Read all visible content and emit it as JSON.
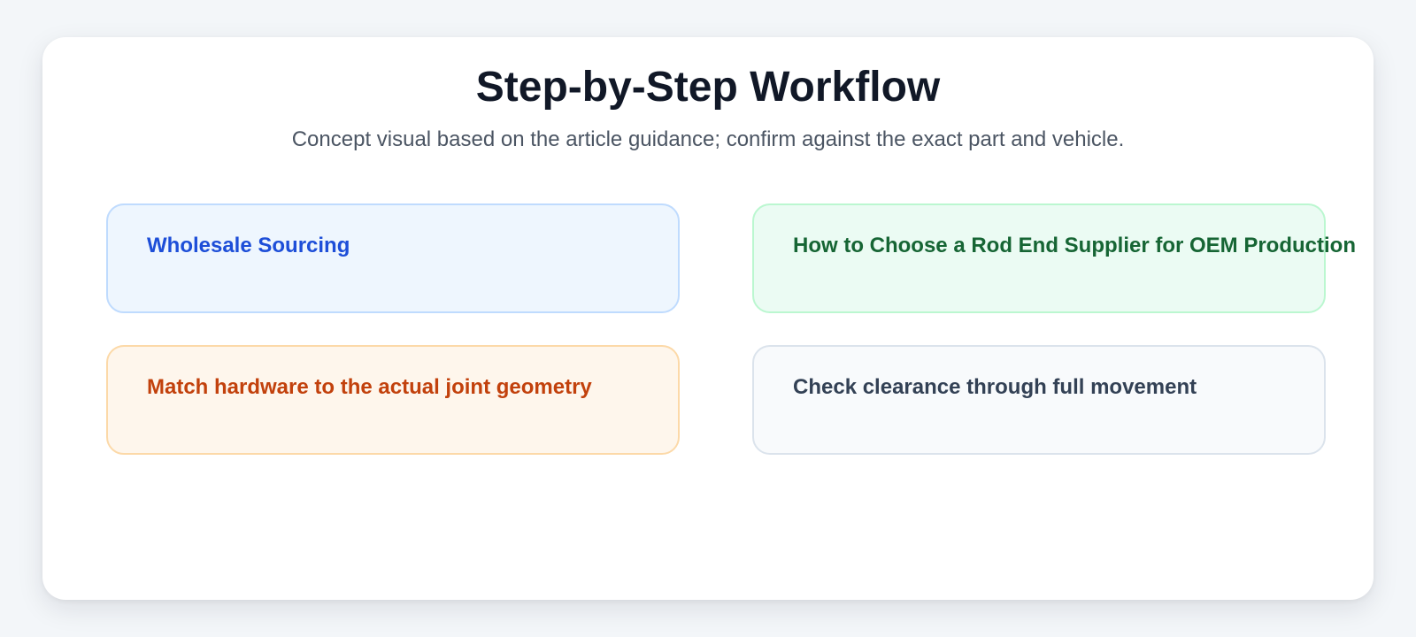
{
  "title": "Step-by-Step Workflow",
  "subtitle": "Concept visual based on the article guidance; confirm against the exact part and vehicle.",
  "steps": [
    {
      "label": "Wholesale Sourcing",
      "background": "#eef6fe",
      "border": "#bfdbfe",
      "text_color": "#1d4ed8"
    },
    {
      "label": "How to Choose a Rod End Supplier for OEM Production",
      "background": "#ebfbf3",
      "border": "#bbf7d0",
      "text_color": "#166534"
    },
    {
      "label": "Match hardware to the actual joint geometry",
      "background": "#fef6ec",
      "border": "#fcd9a8",
      "text_color": "#c2410c"
    },
    {
      "label": "Check clearance through full movement",
      "background": "#f8fafc",
      "border": "#dbe3ec",
      "text_color": "#334155"
    }
  ]
}
